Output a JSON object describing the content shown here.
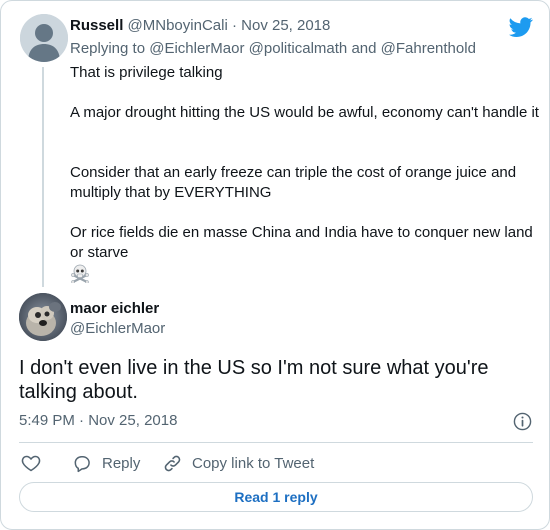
{
  "parent_tweet": {
    "display_name": "Russell",
    "handle": "@MNboyinCali",
    "separator": "·",
    "date": "Nov 25, 2018",
    "replying_to_prefix": "Replying to",
    "replying_to": [
      "@EichlerMaor",
      "@politicalmath",
      "@Fahrenthold"
    ],
    "replying_to_joiner": "and",
    "paragraphs": [
      "That is privilege talking",
      "A major drought hitting the US would be awful, economy can't handle it",
      "Consider that an early freeze can triple the cost of orange juice and multiply that by EVERYTHING",
      "Or rice fields die en masse China and India have to conquer new land or starve"
    ],
    "emoji": "skull-and-crossbones-icon"
  },
  "main_tweet": {
    "display_name": "maor eichler",
    "handle": "@EichlerMaor",
    "text": "I don't even live in the US so I'm not sure what you're talking about.",
    "time": "5:49 PM",
    "separator": "·",
    "date": "Nov 25, 2018"
  },
  "actions": {
    "like_icon": "heart-icon",
    "reply_label": "Reply",
    "copy_link_label": "Copy link to Tweet"
  },
  "read_replies_label": "Read 1 reply",
  "colors": {
    "twitter_blue": "#1d9bf0",
    "link_blue": "#1d6fc2",
    "secondary_text": "#536471",
    "border": "#cfd9de"
  }
}
